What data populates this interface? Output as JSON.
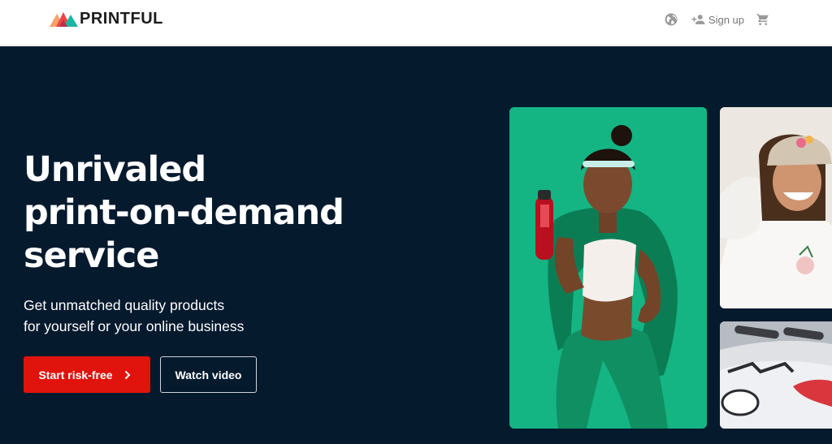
{
  "header": {
    "brand": "PRINTFUL",
    "signup_label": "Sign up",
    "icons": [
      "globe-icon",
      "add-user-icon",
      "cart-icon"
    ]
  },
  "hero": {
    "headline_line1": "Unrivaled",
    "headline_line2": "print-on-demand",
    "headline_line3": "service",
    "subhead_line1": "Get unmatched quality products",
    "subhead_line2": "for yourself or your online business",
    "primary_cta": "Start risk-free",
    "secondary_cta": "Watch video"
  },
  "colors": {
    "hero_bg": "#061a2e",
    "primary_cta": "#e0140c",
    "green_card": "#15b483"
  }
}
